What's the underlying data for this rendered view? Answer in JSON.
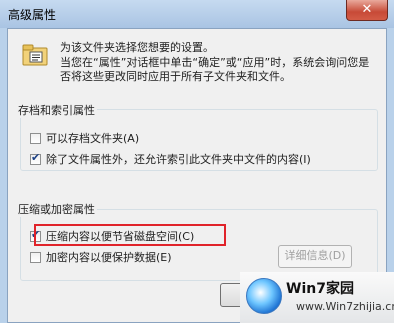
{
  "window": {
    "title": "高级属性",
    "close_symbol": "✕"
  },
  "intro": {
    "line1": "为该文件夹选择您想要的设置。",
    "line2": "当您在“属性”对话框中单击“确定”或“应用”时，系统会询问您是否将这些更改同时应用于所有子文件夹和文件。"
  },
  "archive_group": {
    "title": "存档和索引属性",
    "options": [
      {
        "label": "可以存档文件夹(A)",
        "checked": false
      },
      {
        "label": "除了文件属性外，还允许索引此文件夹中文件的内容(I)",
        "checked": true
      }
    ]
  },
  "compress_group": {
    "title": "压缩或加密属性",
    "options": [
      {
        "label": "压缩内容以便节省磁盘空间(C)",
        "checked": true
      },
      {
        "label": "加密内容以便保护数据(E)",
        "checked": false
      }
    ],
    "details_label": "详细信息(D)"
  },
  "watermark": {
    "title": "Win7家园",
    "url": "www.Win7zhijia.cn"
  }
}
